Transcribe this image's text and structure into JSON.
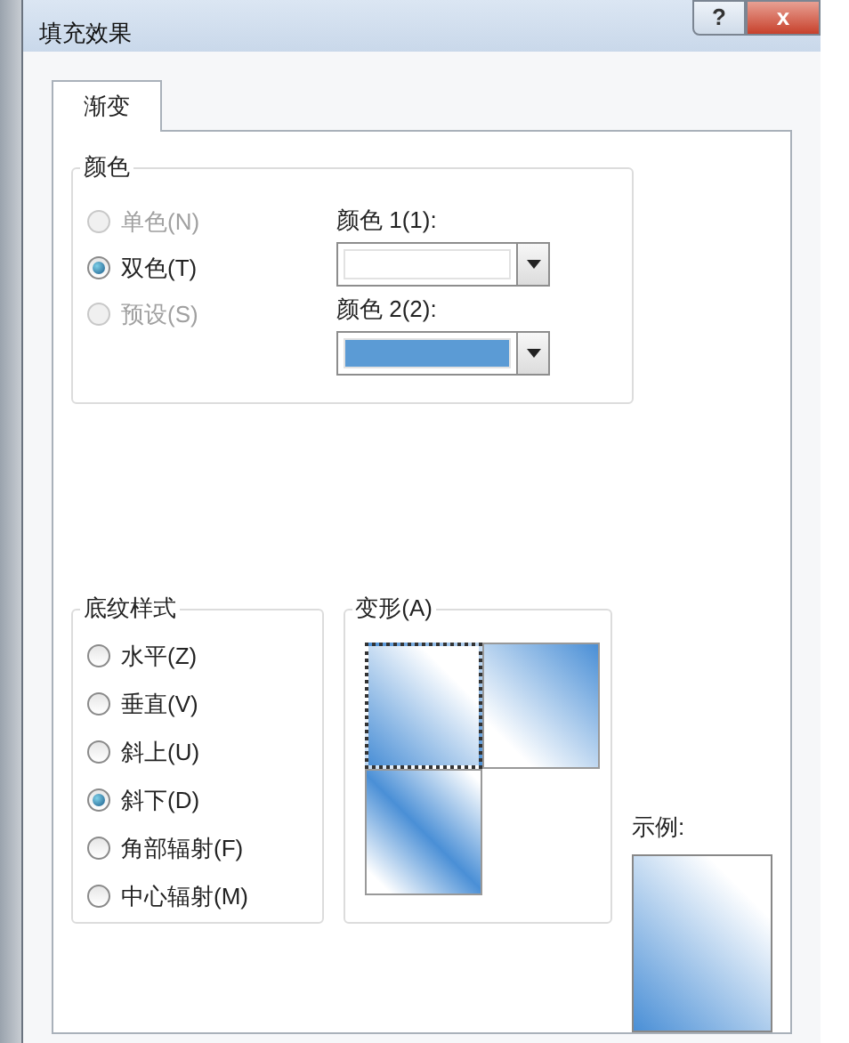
{
  "window": {
    "title": "填充效果",
    "buttons": [
      {
        "kind": "help",
        "label": "?"
      },
      {
        "kind": "close",
        "label": "x"
      }
    ]
  },
  "tabs": [
    {
      "label": "渐变",
      "selected": true
    }
  ],
  "colors_group": {
    "title": "颜色",
    "options": [
      {
        "label": "单色(N)",
        "selected": false,
        "disabled": true
      },
      {
        "label": "双色(T)",
        "selected": true,
        "disabled": false
      },
      {
        "label": "预设(S)",
        "selected": false,
        "disabled": true
      }
    ],
    "pickers": [
      {
        "label": "颜色 1(1):",
        "color": "#ffffff"
      },
      {
        "label": "颜色 2(2):",
        "color": "#5b9bd5"
      }
    ]
  },
  "shading_styles": {
    "title": "底纹样式",
    "options": [
      {
        "label": "水平(Z)",
        "selected": false
      },
      {
        "label": "垂直(V)",
        "selected": false
      },
      {
        "label": "斜上(U)",
        "selected": false
      },
      {
        "label": "斜下(D)",
        "selected": true
      },
      {
        "label": "角部辐射(F)",
        "selected": false
      },
      {
        "label": "中心辐射(M)",
        "selected": false
      }
    ]
  },
  "variants": {
    "title": "变形(A)",
    "items": [
      {
        "kind": "blue-to-white",
        "selected": true
      },
      {
        "kind": "white-to-blue",
        "selected": false
      },
      {
        "kind": "band",
        "selected": false
      }
    ]
  },
  "sample": {
    "label": "示例:"
  }
}
